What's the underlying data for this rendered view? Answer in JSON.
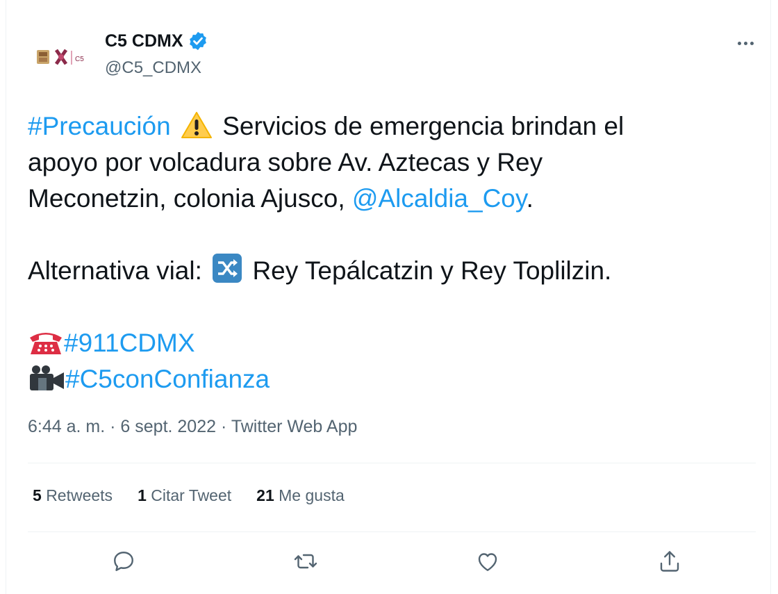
{
  "author": {
    "display_name": "C5 CDMX",
    "handle": "@C5_CDMX",
    "avatar_icon": "c5-cdmx-logo",
    "verified_icon": "verified-badge-icon"
  },
  "tweet": {
    "line1_hashtag": "#Precaución",
    "line1_emoji": "⚠️",
    "line1_text": "Servicios de emergencia brindan el",
    "line2_text": "apoyo por volcadura sobre Av. Aztecas y Rey",
    "line3_text": "Meconetzin, colonia Ajusco,",
    "line3_mention": "@Alcaldia_Coy",
    "line3_end": ".",
    "line4_text": "Alternativa vial:",
    "line4_emoji": "🔀",
    "line4_rest": "Rey Tepálcatzin y Rey Toplilzin.",
    "line5_emoji": "☎️",
    "line5_hashtag": "#911CDMX",
    "line6_emoji": "📹",
    "line6_hashtag": "#C5conConfianza"
  },
  "meta": {
    "time": "6:44 a. m.",
    "sep1": "·",
    "date": "6 sept. 2022",
    "sep2": "·",
    "app": "Twitter Web App"
  },
  "stats": {
    "retweets_count": "5",
    "retweets_label": "Retweets",
    "quotes_count": "1",
    "quotes_label": "Citar Tweet",
    "likes_count": "21",
    "likes_label": "Me gusta"
  },
  "actions": [
    "reply-icon",
    "retweet-icon",
    "like-icon",
    "share-icon"
  ],
  "colors": {
    "link": "#1d9bf0",
    "secondary": "#536471",
    "text": "#0f1419",
    "verified": "#1d9bf0"
  }
}
